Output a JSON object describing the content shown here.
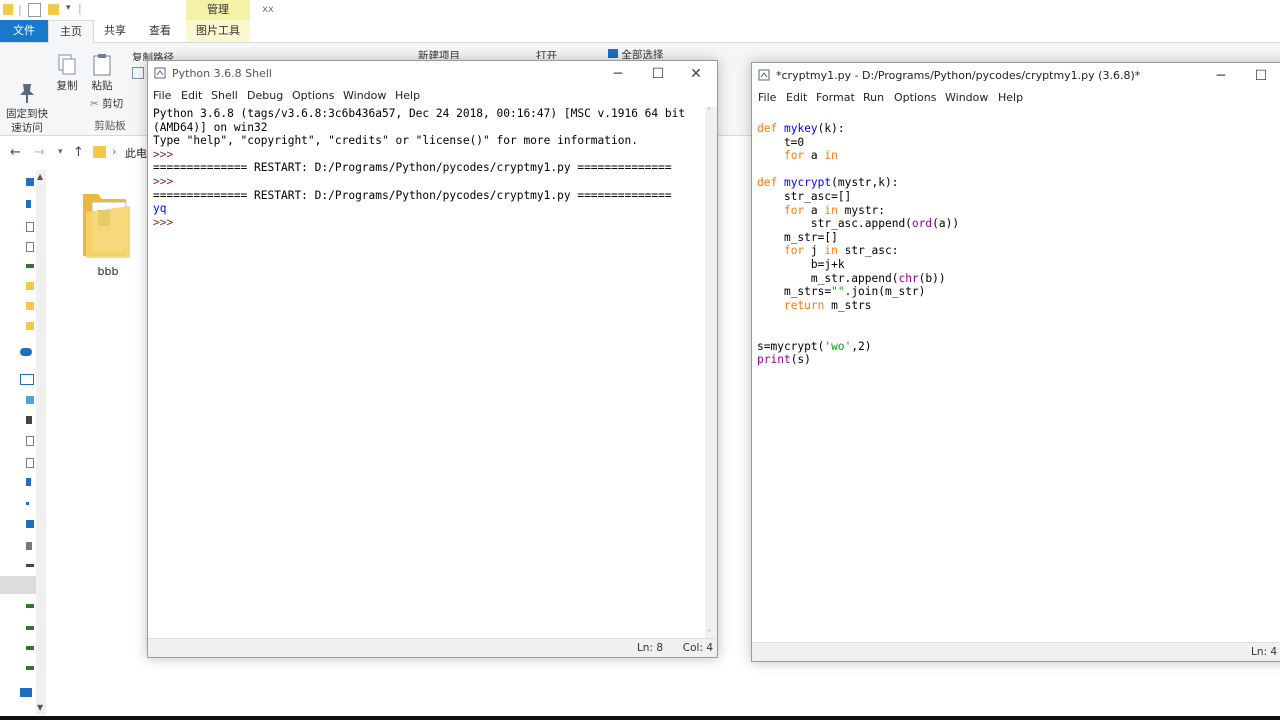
{
  "explorer": {
    "ctx_tab": "管理",
    "title_small": "xx",
    "tabs": [
      "文件",
      "主页",
      "共享",
      "查看",
      "图片工具"
    ],
    "ribbon": {
      "pin": "固定到快\n速访问",
      "copy": "复制",
      "paste": "粘贴",
      "cut": "剪切",
      "copy_path": "复制路径",
      "group_clipboard": "剪贴板",
      "new_item": "新建项目",
      "open": "打开",
      "select_all": "全部选择"
    },
    "address": "此电",
    "folder": "bbb"
  },
  "shell": {
    "title": "Python 3.6.8 Shell",
    "menus": [
      "File",
      "Edit",
      "Shell",
      "Debug",
      "Options",
      "Window",
      "Help"
    ],
    "lines": [
      "Python 3.6.8 (tags/v3.6.8:3c6b436a57, Dec 24 2018, 00:16:47) [MSC v.1916 64 bit",
      "(AMD64)] on win32",
      "Type \"help\", \"copyright\", \"credits\" or \"license()\" for more information.",
      ">>> ",
      "============== RESTART: D:/Programs/Python/pycodes/cryptmy1.py ==============",
      ">>> ",
      "============== RESTART: D:/Programs/Python/pycodes/cryptmy1.py ==============",
      "yq",
      ">>> "
    ],
    "status_ln": "Ln: 8",
    "status_col": "Col: 4"
  },
  "editor": {
    "title": "*cryptmy1.py - D:/Programs/Python/pycodes/cryptmy1.py (3.6.8)*",
    "menus": [
      "File",
      "Edit",
      "Format",
      "Run",
      "Options",
      "Window",
      "Help"
    ],
    "status_ln": "Ln: 4"
  }
}
